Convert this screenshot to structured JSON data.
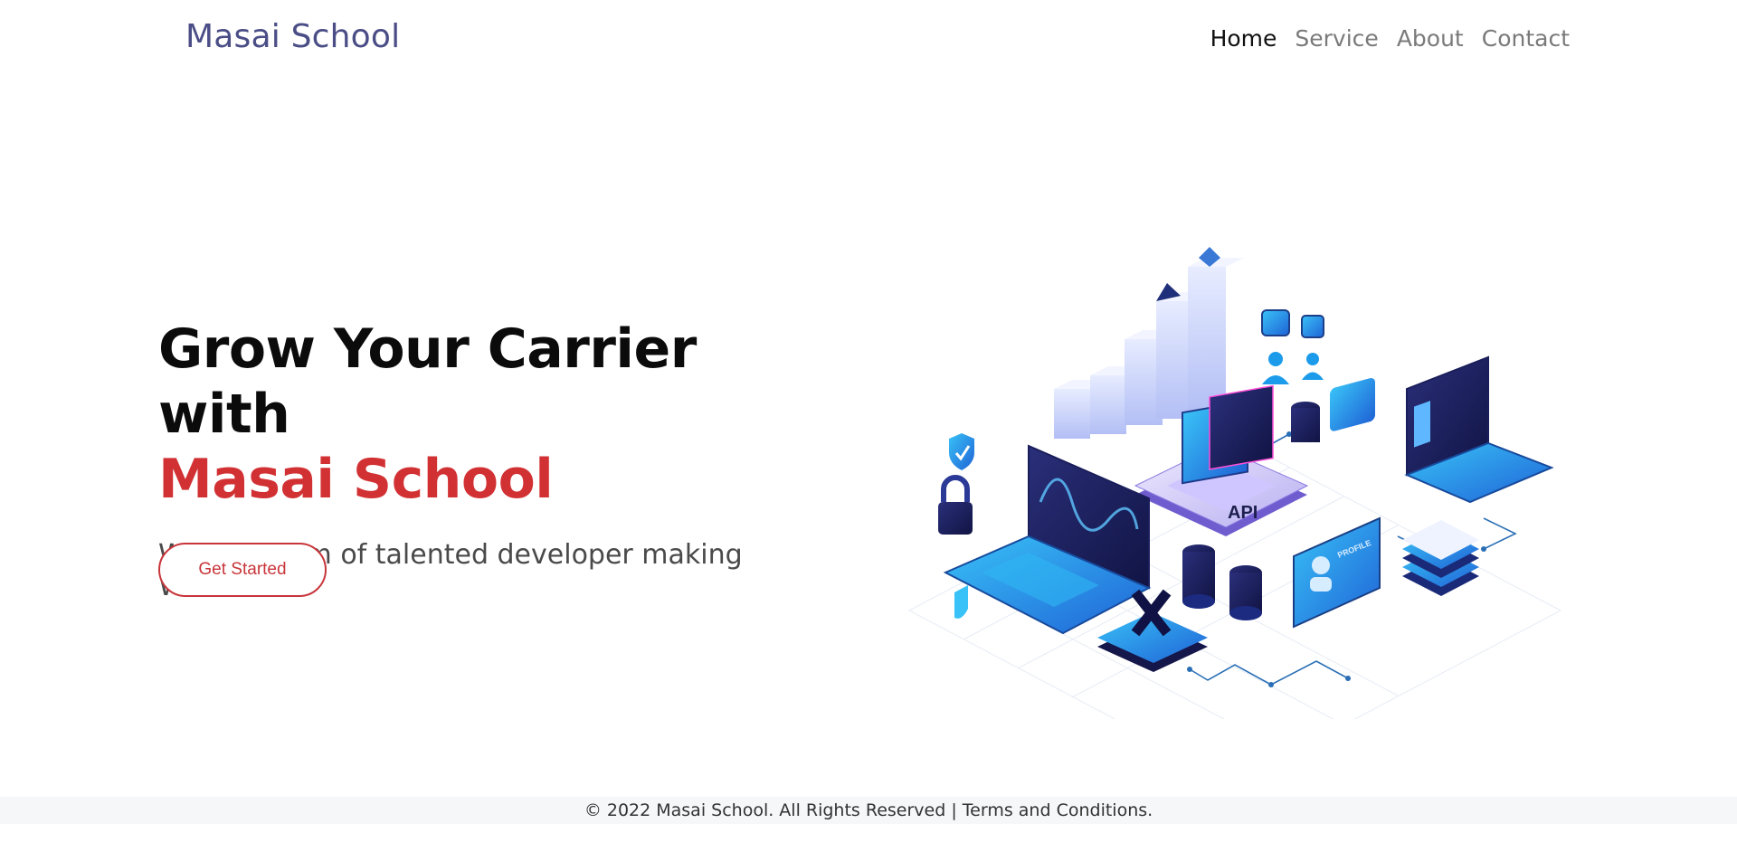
{
  "navbar": {
    "brand": "Masai School",
    "links": [
      {
        "label": "Home",
        "active": true
      },
      {
        "label": "Service",
        "active": false
      },
      {
        "label": "About",
        "active": false
      },
      {
        "label": "Contact",
        "active": false
      }
    ]
  },
  "hero": {
    "title_line1": "Grow Your Carrier with",
    "title_line2": "Masai School",
    "subtitle": "We are team of talented developer making Websites",
    "cta_label": "Get Started",
    "illustration_labels": {
      "api": "API",
      "profile": "PROFILE"
    }
  },
  "footer": {
    "copyright": "© 2022 Masai School. All Rights Reserved |",
    "terms": "Terms and Conditions."
  },
  "colors": {
    "brand": "#4b4e86",
    "accent_red": "#d23134",
    "illustration_blue": "#1c9bea",
    "footer_bg": "#f6f7f8"
  }
}
